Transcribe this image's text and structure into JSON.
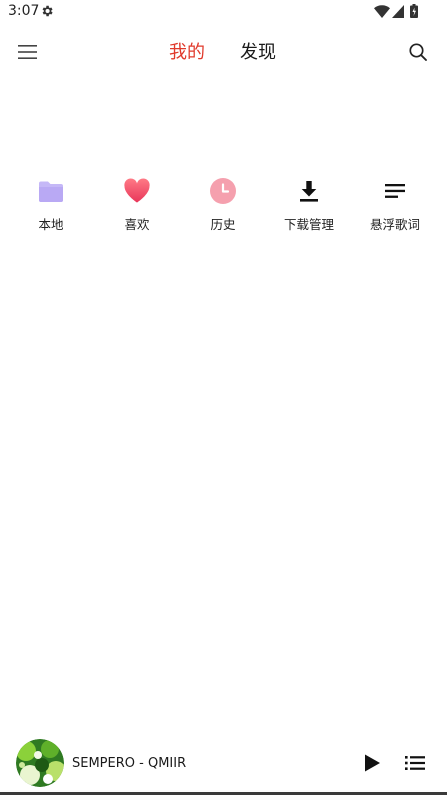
{
  "status_bar": {
    "time": "3:07",
    "icons": [
      "gear-icon",
      "wifi-icon",
      "signal-icon",
      "battery-icon"
    ]
  },
  "top_nav": {
    "menu_icon": "hamburger-menu-icon",
    "tabs": [
      {
        "label": "我的",
        "active": true
      },
      {
        "label": "发现",
        "active": false
      }
    ],
    "search_icon": "search-icon",
    "accent_color": "#e0392b"
  },
  "quick_actions": [
    {
      "label": "本地",
      "icon": "folder-icon",
      "color": "#c5b8f7"
    },
    {
      "label": "喜欢",
      "icon": "heart-icon",
      "color": "#f0506e"
    },
    {
      "label": "历史",
      "icon": "clock-icon",
      "color": "#f5a0ae"
    },
    {
      "label": "下载管理",
      "icon": "download-icon",
      "color": "#111111"
    },
    {
      "label": "悬浮歌词",
      "icon": "lyrics-icon",
      "color": "#111111"
    }
  ],
  "player": {
    "track": "SEMPERO - QMIIR",
    "play_icon": "play-icon",
    "playlist_icon": "playlist-icon"
  }
}
